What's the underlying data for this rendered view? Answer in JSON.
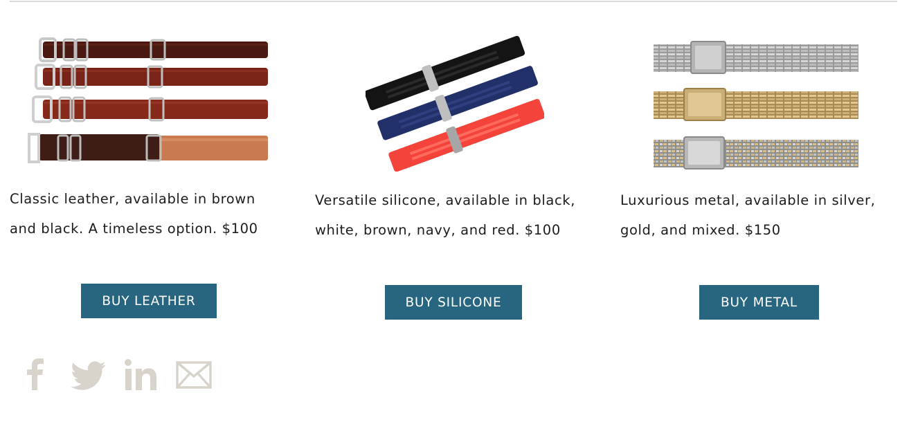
{
  "products": [
    {
      "id": "leather",
      "image_alt": "Leather watch straps",
      "desc_line1": "Classic leather, available in brown",
      "desc_line2": "and black.  A timeless option. $100",
      "button_label": "BUY LEATHER",
      "colors": [
        "#5a1f14",
        "#7a2a1c",
        "#8a3420",
        "#c97a4e"
      ]
    },
    {
      "id": "silicone",
      "image_alt": "Silicone watch straps",
      "desc_line1": "Versatile silicone, available in black,",
      "desc_line2": "white, brown, navy, and red. $100",
      "button_label": "BUY SILICONE",
      "colors": [
        "#141414",
        "#22306a",
        "#f4433a"
      ]
    },
    {
      "id": "metal",
      "image_alt": "Metal watch bracelets",
      "desc_line1": "Luxurious metal, available in silver,",
      "desc_line2": "gold, and mixed.  $150",
      "button_label": "BUY METAL",
      "colors": [
        "#9a9a9a",
        "#c9ae77",
        "#b7ad94"
      ]
    }
  ],
  "social": [
    {
      "name": "facebook-icon"
    },
    {
      "name": "twitter-icon"
    },
    {
      "name": "linkedin-icon"
    },
    {
      "name": "email-icon"
    }
  ],
  "theme": {
    "button_bg": "#286580",
    "button_text": "#ffffff",
    "social_icon_color": "#d8d4cc"
  }
}
